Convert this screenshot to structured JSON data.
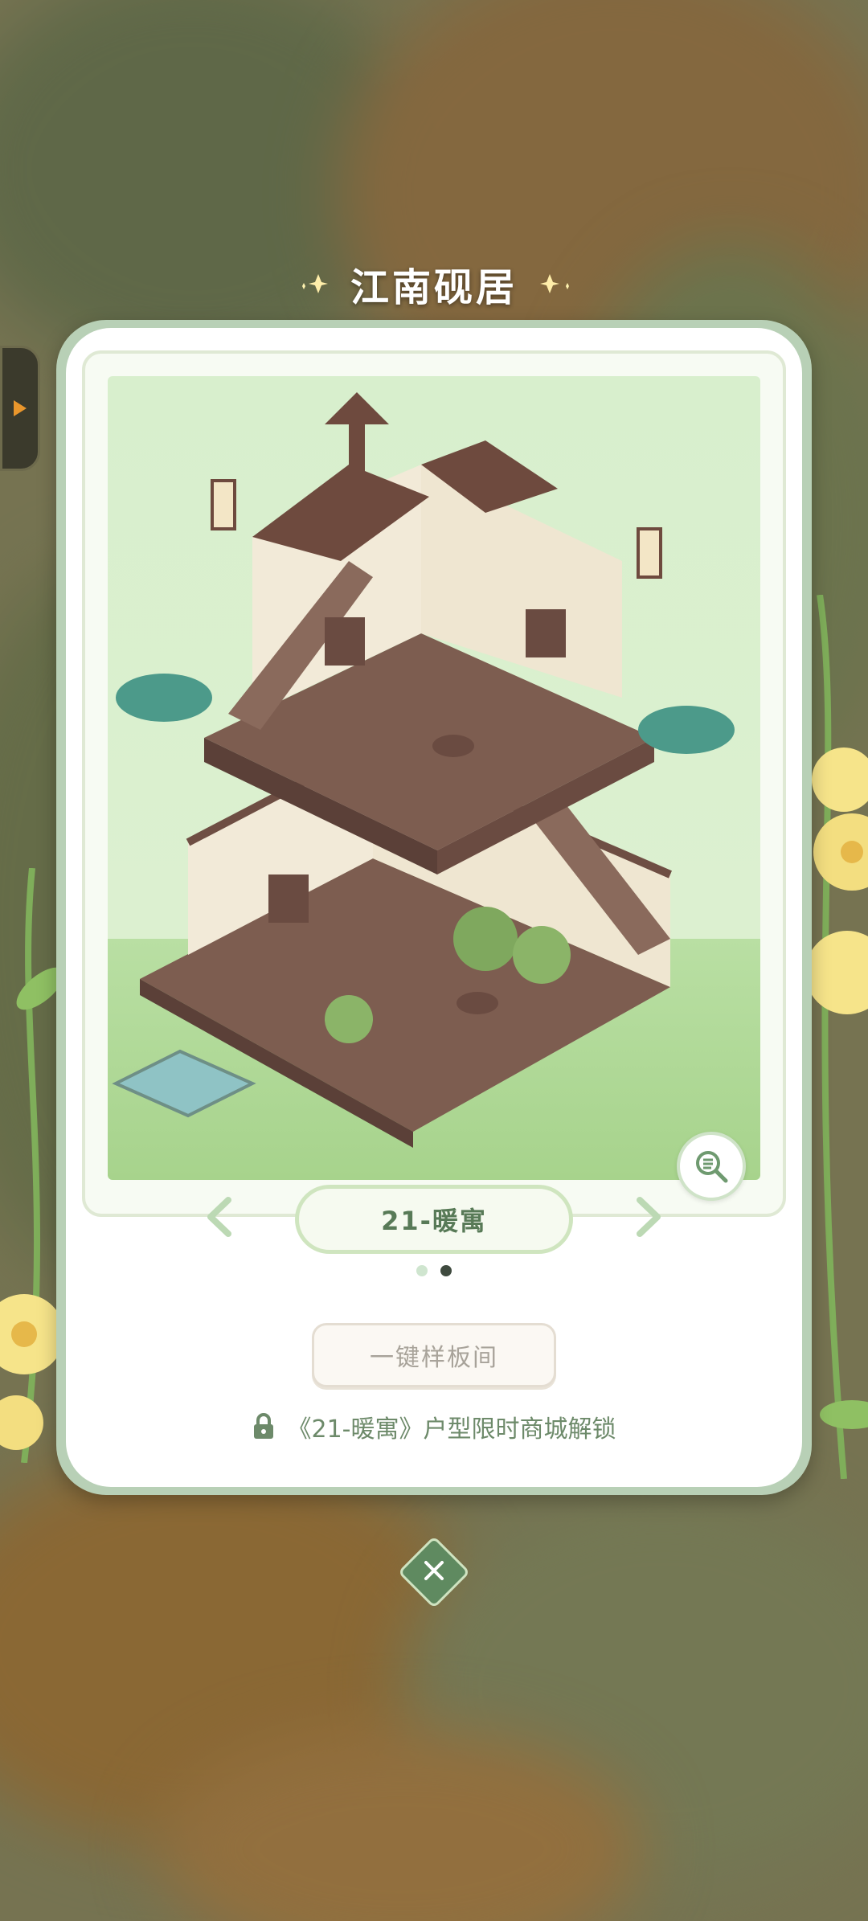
{
  "header": {
    "title": "江南砚居"
  },
  "card": {
    "layout_name": "21-暖寓",
    "pagination": {
      "count": 2,
      "active_index": 1
    },
    "template_button_label": "一键样板间",
    "unlock_text": "《21-暖寓》户型限时商城解锁"
  },
  "icons": {
    "side_tab": "play-arrow-icon",
    "zoom": "search-list-icon",
    "prev": "chevron-left-icon",
    "next": "chevron-right-icon",
    "lock": "lock-icon",
    "close": "close-icon"
  },
  "colors": {
    "accent_green": "#5f8a60",
    "plate_text": "#587a57",
    "unlock_text": "#6d8a6a",
    "dot_inactive": "#cfe5cf",
    "dot_active": "#3f4a3f"
  }
}
